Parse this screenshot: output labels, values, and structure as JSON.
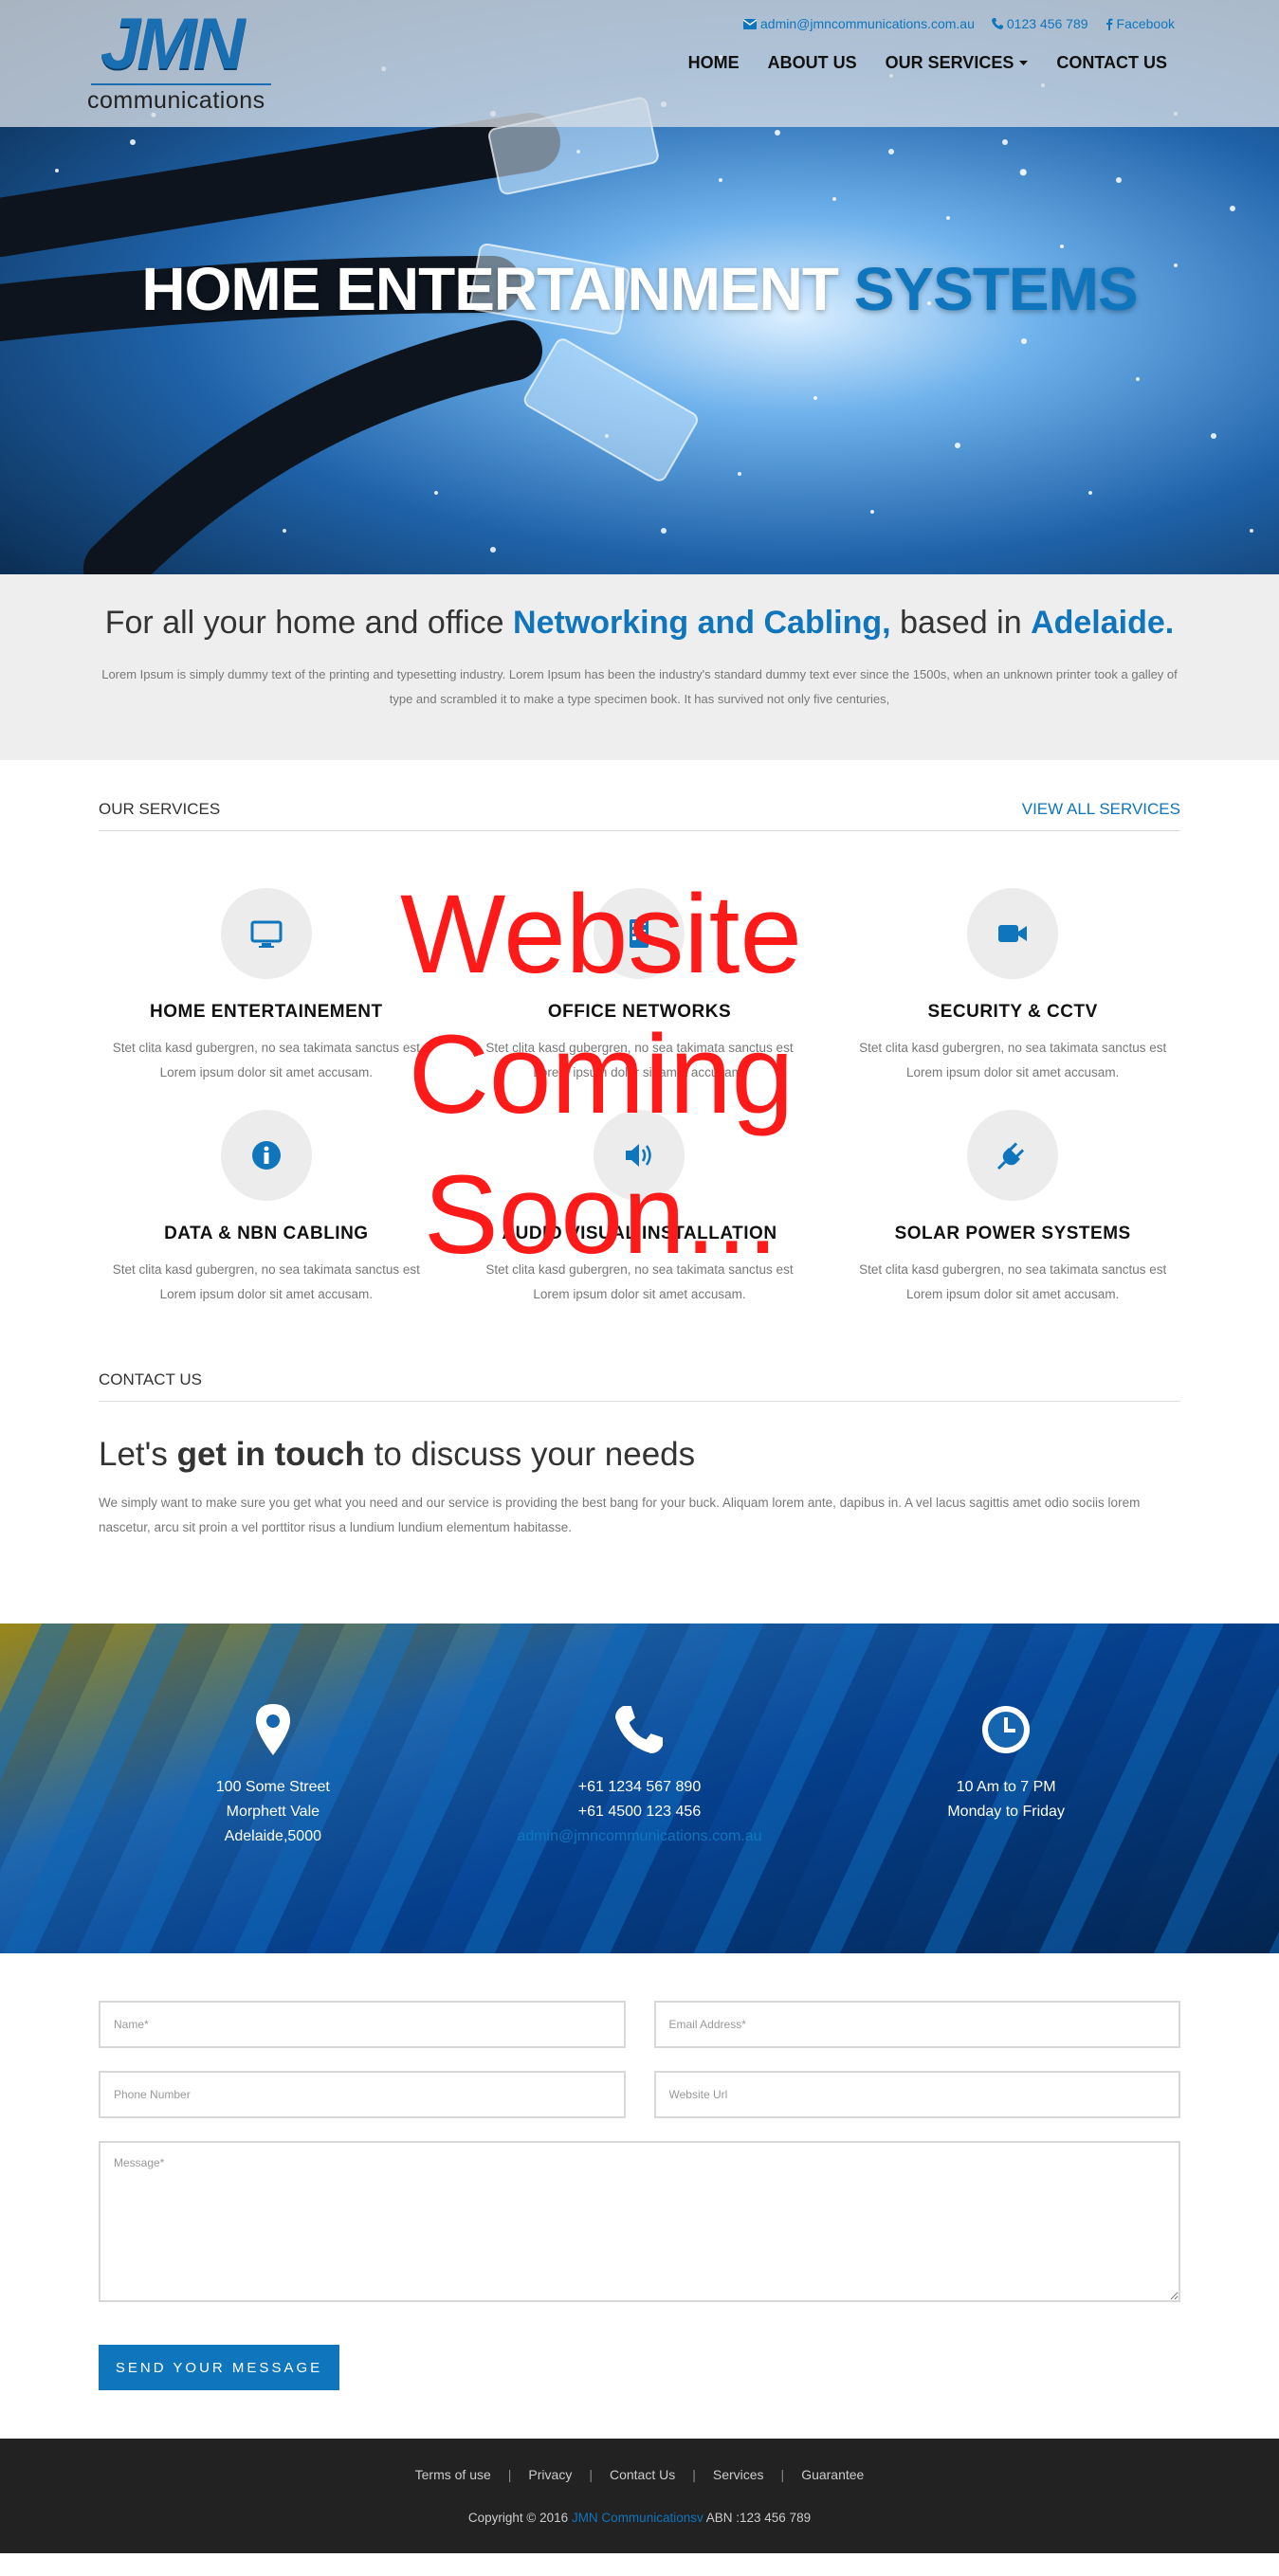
{
  "header": {
    "logo_mark": "JMN",
    "logo_sub": "communications",
    "email": "admin@jmncommunications.com.au",
    "phone": "0123 456 789",
    "facebook": "Facebook",
    "nav": [
      "HOME",
      "ABOUT US",
      "OUR SERVICES",
      "CONTACT US"
    ]
  },
  "hero": {
    "title_white": "HOME ENTERTAINMENT",
    "title_blue": "SYSTEMS"
  },
  "intro": {
    "lead": "For all your home and office",
    "highlight1": "Networking and Cabling,",
    "mid": "based in",
    "highlight2": "Adelaide.",
    "body": "Lorem Ipsum is simply dummy text of the printing and typesetting industry. Lorem Ipsum has been the industry's standard dummy text ever since the 1500s, when an unknown printer took a galley of type and scrambled it to make a type specimen book. It has survived not only five centuries,"
  },
  "services": {
    "heading": "OUR SERVICES",
    "view_all": "VIEW ALL SERVICES",
    "items": [
      {
        "title": "HOME ENTERTAINEMENT",
        "desc": "Stet clita kasd gubergren, no sea takimata sanctus est Lorem ipsum dolor sit amet accusam.",
        "icon": "monitor-icon"
      },
      {
        "title": "OFFICE NETWORKS",
        "desc": "Stet clita kasd gubergren, no sea takimata sanctus est Lorem ipsum dolor sit amet accusam.",
        "icon": "network-icon"
      },
      {
        "title": "SECURITY & CCTV",
        "desc": "Stet clita kasd gubergren, no sea takimata sanctus est Lorem ipsum dolor sit amet accusam.",
        "icon": "video-camera-icon"
      },
      {
        "title": "DATA & NBN CABLING",
        "desc": "Stet clita kasd gubergren, no sea takimata sanctus est Lorem ipsum dolor sit amet accusam.",
        "icon": "info-icon"
      },
      {
        "title": "AUDIO VISUAL INSTALLATION",
        "desc": "Stet clita kasd gubergren, no sea takimata sanctus est Lorem ipsum dolor sit amet accusam.",
        "icon": "speaker-icon"
      },
      {
        "title": "SOLAR POWER SYSTEMS",
        "desc": "Stet clita kasd gubergren, no sea takimata sanctus est Lorem ipsum dolor sit amet accusam.",
        "icon": "plug-icon"
      }
    ]
  },
  "overlay": {
    "line1": "Website",
    "line2": "Coming",
    "line3": "Soon..."
  },
  "contact": {
    "heading": "CONTACT US",
    "title_pre": "Let's",
    "title_bold": "get in touch",
    "title_post": "to discuss your needs",
    "body": "We simply want to make sure you get what you need and our service is providing the best bang for your buck. Aliquam lorem ante, dapibus in. A vel lacus sagittis amet odio sociis lorem nascetur, arcu sit proin a vel porttitor risus a lundium lundium elementum habitasse."
  },
  "info": {
    "address": [
      "100 Some Street",
      "Morphett Vale",
      "Adelaide,5000"
    ],
    "phones": [
      "+61 1234 567 890",
      "+61 4500 123 456"
    ],
    "email": "admin@jmncommunications.com.au",
    "hours": [
      "10 Am to 7 PM",
      "Monday to Friday"
    ]
  },
  "form": {
    "name_ph": "Name*",
    "email_ph": "Email Address*",
    "phone_ph": "Phone Number",
    "website_ph": "Website Url",
    "message_ph": "Message*",
    "submit": "SEND YOUR MESSAGE"
  },
  "footer": {
    "links": [
      "Terms of use",
      "Privacy",
      "Contact Us",
      "Services",
      "Guarantee"
    ],
    "copy_pre": "Copyright © 2016",
    "copy_brand": "JMN Communicationsv",
    "copy_post": "ABN :123 456 789"
  },
  "colors": {
    "accent": "#0f75bc",
    "overlay": "#ff1a1a",
    "footer_bg": "#222222"
  }
}
